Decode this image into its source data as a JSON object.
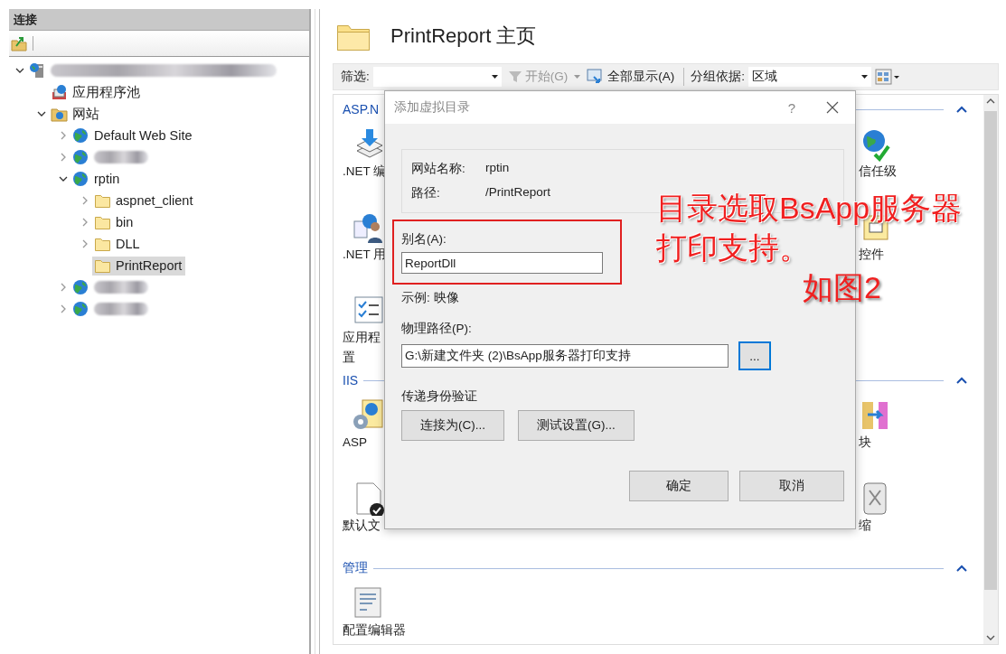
{
  "connections": {
    "title": "连接",
    "tree": [
      {
        "kind": "server",
        "redacted": true,
        "expanded": true,
        "selected": false,
        "children": [
          {
            "kind": "pool",
            "label": "应用程序池",
            "selected": false
          },
          {
            "kind": "sites",
            "label": "网站",
            "expanded": true,
            "selected": false,
            "children": [
              {
                "kind": "site",
                "label": "Default Web Site",
                "expanded": false,
                "selected": false
              },
              {
                "kind": "site",
                "redacted": true,
                "expanded": false,
                "selected": false
              },
              {
                "kind": "site",
                "label": "rptin",
                "expanded": true,
                "selected": false,
                "children": [
                  {
                    "kind": "folder",
                    "label": "aspnet_client",
                    "expanded": false,
                    "selected": false
                  },
                  {
                    "kind": "folder",
                    "label": "bin",
                    "expanded": false,
                    "selected": false
                  },
                  {
                    "kind": "folder",
                    "label": "DLL",
                    "expanded": false,
                    "selected": false
                  },
                  {
                    "kind": "folder",
                    "label": "PrintReport",
                    "selected": true
                  }
                ]
              },
              {
                "kind": "site",
                "redacted": true,
                "expanded": false,
                "selected": false
              },
              {
                "kind": "site",
                "redacted": true,
                "expanded": false,
                "selected": false
              }
            ]
          }
        ]
      }
    ]
  },
  "home": {
    "title": "PrintReport 主页",
    "filter_bar": {
      "filter_label": "筛选:",
      "start": {
        "label": "开始(G)",
        "disabled": true
      },
      "show_all": "全部显示(A)",
      "group_label": "分组依据:",
      "group_value": "区域"
    },
    "groups": [
      {
        "title": "ASP.N",
        "expanded": true,
        "rows": [
          {
            "left": {
              "kind": "stack",
              "lines": [
                ".NET 编"
              ]
            },
            "right": {
              "kind": "globe-check",
              "lines": [
                "信任级"
              ]
            }
          },
          {
            "left": {
              "kind": "users",
              "lines": [
                ".NET 用"
              ]
            },
            "right": {
              "kind": "control",
              "lines": [
                "控件"
              ]
            }
          },
          {
            "left": {
              "kind": "checklist",
              "lines": [
                "应用程",
                "置"
              ]
            }
          }
        ]
      },
      {
        "title": "IIS",
        "expanded": true,
        "rows": [
          {
            "left": {
              "kind": "gear-doc",
              "lines": [
                "ASP"
              ]
            },
            "right": {
              "kind": "module",
              "lines": [
                "块"
              ]
            }
          },
          {
            "left": {
              "kind": "doc-check",
              "lines": [
                "默认文"
              ]
            },
            "right": {
              "kind": "compress",
              "lines": [
                "缩"
              ]
            }
          }
        ]
      },
      {
        "title": "管理",
        "expanded": true,
        "rows": [
          {
            "left": {
              "kind": "editor",
              "lines": [
                "配置编辑器"
              ]
            }
          }
        ]
      }
    ]
  },
  "dialog": {
    "title": "添加虚拟目录",
    "help": "?",
    "info": [
      {
        "label": "网站名称:",
        "value": "rptin"
      },
      {
        "label": "路径:",
        "value": "/PrintReport"
      }
    ],
    "alias": {
      "label": "别名(A):",
      "value": "ReportDll",
      "highlighted": true
    },
    "example": "示例: 映像",
    "physical_path": {
      "label": "物理路径(P):",
      "value": "G:\\新建文件夹 (2)\\BsApp服务器打印支持",
      "browse": "...",
      "browse_focused": true
    },
    "auth_title": "传递身份验证",
    "auth_buttons": [
      "连接为(C)...",
      "测试设置(G)..."
    ],
    "buttons": [
      "确定",
      "取消"
    ]
  },
  "annotation": {
    "lines": [
      "目录选取BsApp服务器",
      "打印支持。"
    ],
    "note": "如图2"
  }
}
